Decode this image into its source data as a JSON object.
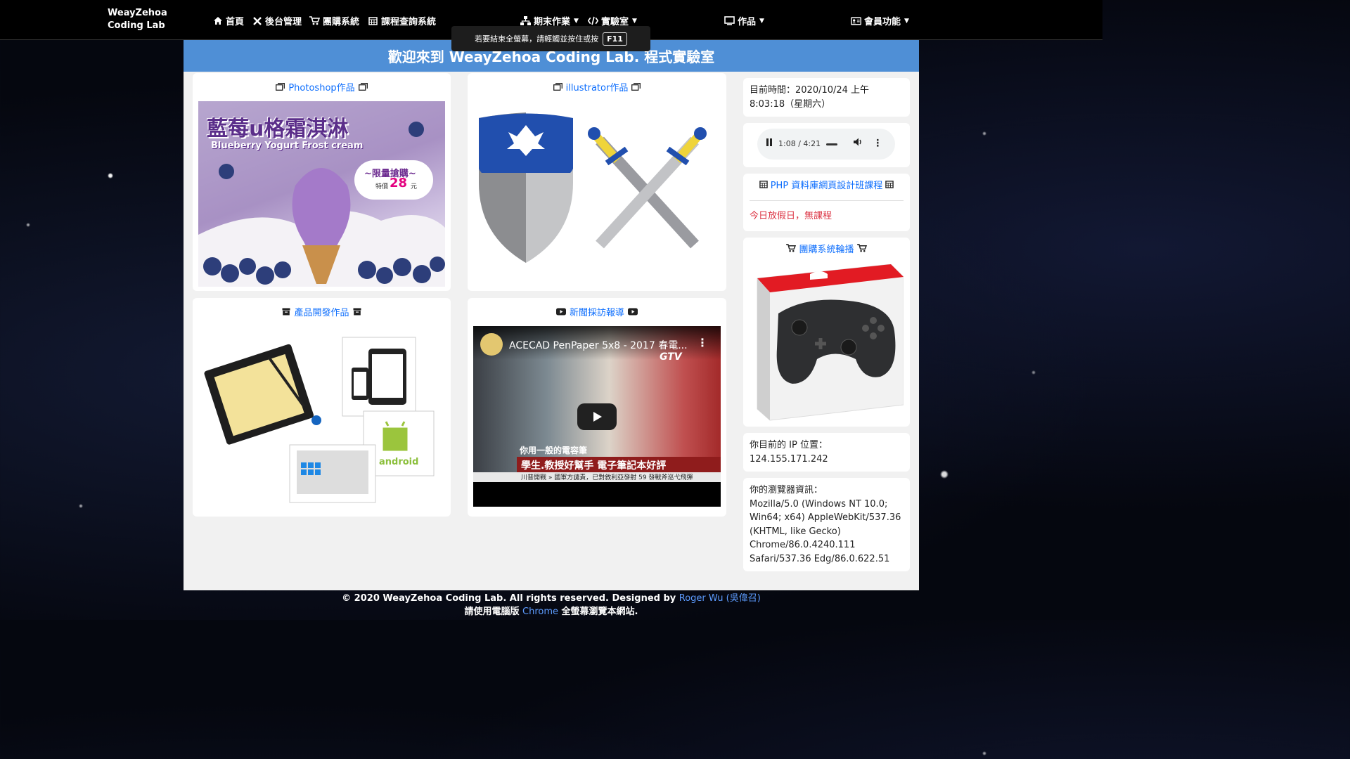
{
  "nav": {
    "brand_line1": "WeayZehoa",
    "brand_line2": "Coding Lab",
    "items": [
      {
        "label": "首頁",
        "icon": "home-icon"
      },
      {
        "label": "後台管理",
        "icon": "tools-icon"
      },
      {
        "label": "團購系統",
        "icon": "cart-icon"
      },
      {
        "label": "課程查詢系統",
        "icon": "calendar-icon"
      },
      {
        "label": "期末作業",
        "icon": "sitemap-icon",
        "dropdown": true
      },
      {
        "label": "實驗室",
        "icon": "code-icon",
        "dropdown": true
      },
      {
        "label": "作品",
        "icon": "portfolio-icon",
        "dropdown": true
      },
      {
        "label": "會員功能",
        "icon": "id-card-icon",
        "dropdown": true
      }
    ]
  },
  "fullscreen_tip": {
    "text": "若要結束全螢幕，請輕觸並按住或按",
    "key": "F11"
  },
  "banner": {
    "title": "歡迎來到 WeayZehoa Coding Lab. 程式實驗室"
  },
  "cards": {
    "photoshop": {
      "title": "Photoshop作品",
      "image_title": "藍莓u格霜淇淋",
      "image_subtitle": "Blueberry Yogurt Frost cream",
      "badge": "~限量搶購~",
      "price_label": "特價",
      "price": "28",
      "price_unit": "元"
    },
    "illustrator": {
      "title": "illustrator作品"
    },
    "product": {
      "title": "產品開發作品",
      "android_label": "android"
    },
    "news": {
      "title": "新聞採訪報導",
      "video_title": "ACECAD PenPaper 5x8 - 2017 春電...",
      "caption1": "你用一般的電容筆",
      "caption2": "學生.教授好幫手  電子筆記本好評",
      "ticker": "川普開戰 » 國軍方譴責，已對敘利亞發射 59 發戰斧巡弋飛彈",
      "logo": "GTV"
    }
  },
  "sidebar": {
    "time_label": "目前時間：2020/10/24 上午8:03:18（星期六）",
    "audio_time": "1:08 / 4:21",
    "course_title": "PHP 資料庫網頁設計班課程",
    "course_note": "今日放假日，無課程",
    "carousel_title": "團購系統輪播",
    "ip_label": "你目前的 IP 位置：",
    "ip_value": "124.155.171.242",
    "browser_label": "你的瀏覽器資訊：",
    "browser_value": "Mozilla/5.0 (Windows NT 10.0; Win64; x64) AppleWebKit/537.36 (KHTML, like Gecko) Chrome/86.0.4240.111 Safari/537.36 Edg/86.0.622.51"
  },
  "footer": {
    "line1_prefix": "© 2020 WeayZehoa Coding Lab. All rights reserved. Designed by ",
    "line1_link": "Roger Wu (吳偉召)",
    "line2_prefix": "請使用電腦版 ",
    "line2_link": "Chrome",
    "line2_suffix": " 全螢幕瀏覽本網站."
  },
  "colors": {
    "accent": "#0d6efd",
    "banner": "#4f8fd6",
    "alert": "#dc3545"
  }
}
